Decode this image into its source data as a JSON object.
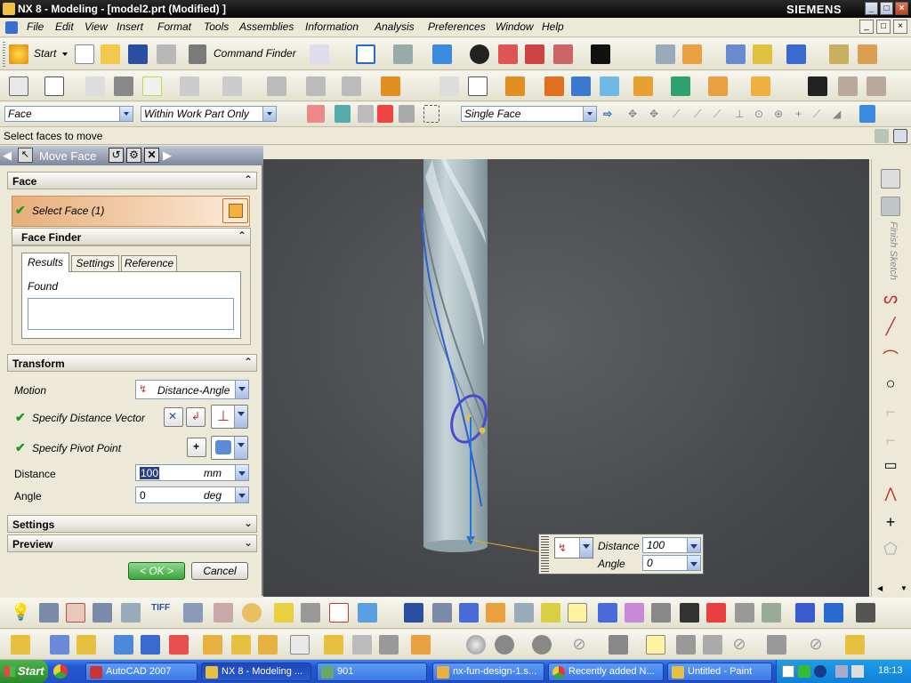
{
  "window": {
    "title": "NX 8 - Modeling - [model2.prt (Modified) ]",
    "brand": "SIEMENS",
    "controls": [
      "_",
      "□",
      "×"
    ]
  },
  "menu": {
    "items": [
      "File",
      "Edit",
      "View",
      "Insert",
      "Format",
      "Tools",
      "Assemblies",
      "Information",
      "Analysis",
      "Preferences",
      "Window",
      "Help"
    ]
  },
  "toolbar1": {
    "start_label": "Start",
    "command_finder_label": "Command Finder"
  },
  "selection_bar": {
    "type_filter": "Face",
    "scope": "Within Work Part Only",
    "face_rule": "Single Face"
  },
  "cue_line": "Select faces to move",
  "dialog": {
    "title": "Move Face",
    "face_section": {
      "header": "Face",
      "select_face_label": "Select Face (1)"
    },
    "face_finder": {
      "header": "Face Finder",
      "tabs": [
        "Results",
        "Settings",
        "Reference"
      ],
      "active_tab": "Results",
      "found_label": "Found"
    },
    "transform": {
      "header": "Transform",
      "motion_label": "Motion",
      "motion_value": "Distance-Angle",
      "distance_vector_label": "Specify Distance Vector",
      "pivot_point_label": "Specify Pivot Point",
      "distance_label": "Distance",
      "distance_value": "100",
      "distance_unit": "mm",
      "angle_label": "Angle",
      "angle_value": "0",
      "angle_unit": "deg"
    },
    "settings_header": "Settings",
    "preview_header": "Preview",
    "ok_label": "< OK >",
    "cancel_label": "Cancel"
  },
  "onscreen_input": {
    "distance_label": "Distance",
    "distance_value": "100",
    "angle_label": "Angle",
    "angle_value": "0"
  },
  "right_toolbar": {
    "finish_sketch_label": "Finish Sketch"
  },
  "taskbar": {
    "start_label": "Start",
    "tasks": [
      "AutoCAD 2007",
      "NX 8 - Modeling ...",
      "901",
      "nx-fun-design-1.s...",
      "Recently added N...",
      "Untitled - Paint"
    ],
    "clock": "18:13"
  },
  "colors": {
    "titlebar": "#0a0a0a",
    "viewport_bg": "#4f5155",
    "part_surface": "#a9bcc0",
    "pivot_handle": "#4a4ad0",
    "select_highlight": "#eab483",
    "taskbar": "#2457cf"
  }
}
